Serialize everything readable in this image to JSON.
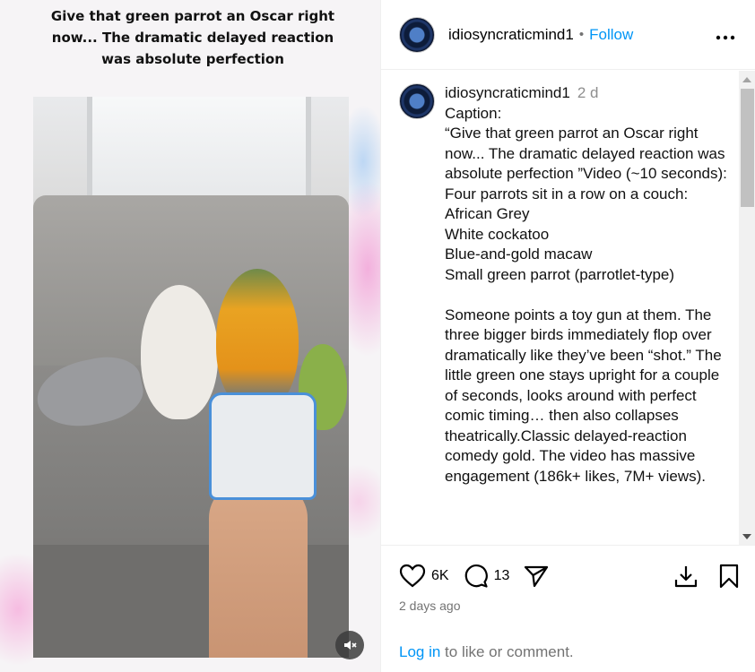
{
  "media": {
    "overlay_caption": "Give that green parrot an Oscar right now... The dramatic delayed reaction was absolute perfection",
    "mute_icon": "speaker-muted-icon"
  },
  "post": {
    "author": "idiosyncraticmind1",
    "separator": "•",
    "follow_label": "Follow",
    "more_icon": "more-horizontal-icon"
  },
  "comment": {
    "author": "idiosyncraticmind1",
    "time": "2 d",
    "text": "Caption:\n“Give that green parrot an Oscar right now... The dramatic delayed reaction was absolute perfection ”Video (~10 seconds):\nFour parrots sit in a row on a couch:\nAfrican Grey\nWhite cockatoo\nBlue-and-gold macaw\nSmall green parrot (parrotlet-type)\n\nSomeone points a toy gun at them. The three bigger birds immediately flop over dramatically like they’ve been “shot.” The little green one stays upright for a couple of seconds, looks around with perfect comic timing… then also collapses theatrically.Classic delayed-reaction comedy gold. The video has massive engagement (186k+ likes, 7M+ views)."
  },
  "actions": {
    "likes": "6K",
    "comments": "13",
    "icons": [
      "heart-icon",
      "comment-icon",
      "share-icon",
      "download-icon",
      "bookmark-icon"
    ]
  },
  "posted_ago": "2 days ago",
  "login": {
    "link": "Log in",
    "suffix": " to like or comment."
  }
}
